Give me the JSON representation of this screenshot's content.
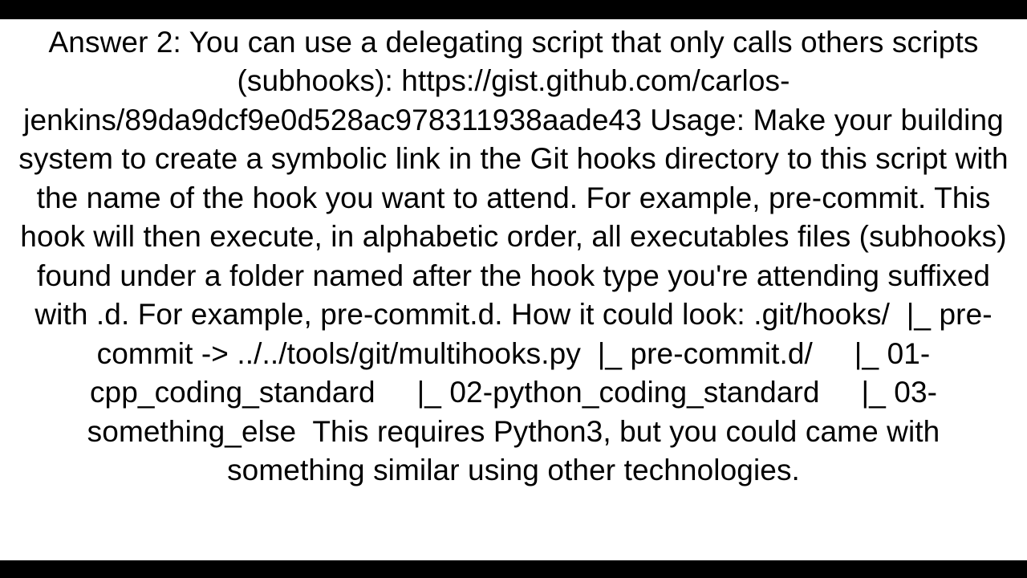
{
  "answer": {
    "text": "Answer 2: You can use a delegating script that only calls others scripts (subhooks): https://gist.github.com/carlos-jenkins/89da9dcf9e0d528ac978311938aade43 Usage: Make your building system to create a symbolic link in the Git hooks directory to this script with the name of the hook you want to attend. For example, pre-commit. This hook will then execute, in alphabetic order, all executables files (subhooks) found under a folder named after the hook type you're attending suffixed with .d. For example, pre-commit.d. How it could look: .git/hooks/  |_ pre-commit -> ../../tools/git/multihooks.py  |_ pre-commit.d/     |_ 01-cpp_coding_standard     |_ 02-python_coding_standard     |_ 03-something_else  This requires Python3, but you could came with something similar using other technologies."
  }
}
